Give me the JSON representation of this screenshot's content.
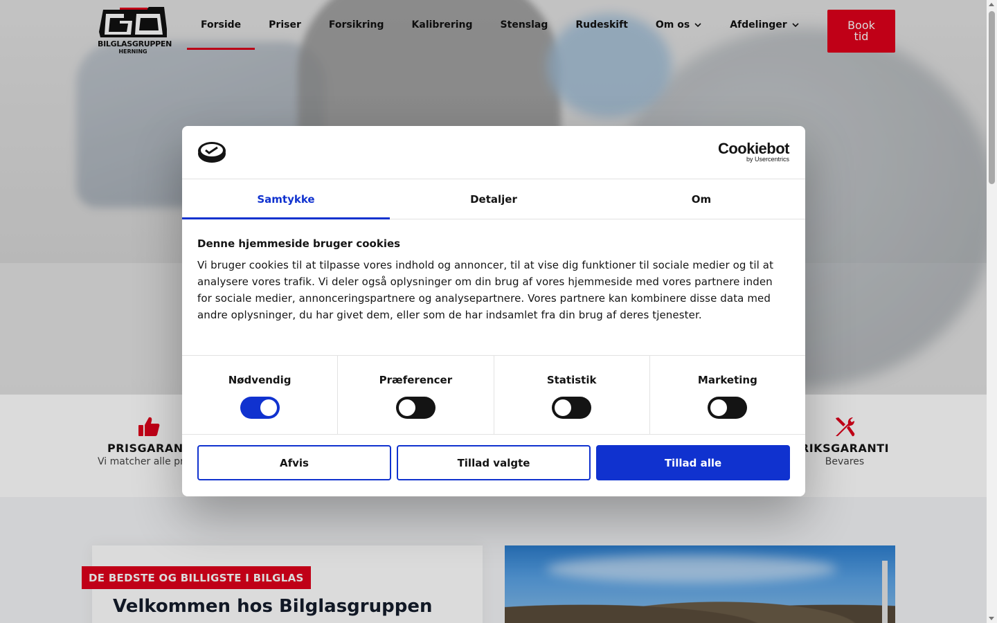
{
  "header": {
    "logo_text": "BILGLASGRUPPEN",
    "logo_sub": "HERNING",
    "nav": [
      {
        "label": "Forside",
        "active": true
      },
      {
        "label": "Priser"
      },
      {
        "label": "Forsikring"
      },
      {
        "label": "Kalibrering"
      },
      {
        "label": "Stenslag"
      },
      {
        "label": "Rudeskift"
      },
      {
        "label": "Om os",
        "dropdown": true
      },
      {
        "label": "Afdelinger",
        "dropdown": true
      }
    ],
    "book_button": "Book\ntid"
  },
  "features": {
    "left": {
      "title": "PRISGARANT",
      "subtitle": "Vi matcher alle pr",
      "icon": "thumbs-up-icon"
    },
    "right": {
      "title": "RIKSGARANTI",
      "subtitle": "Bevares",
      "icon": "tools-icon"
    }
  },
  "content": {
    "badge": "DE BEDSTE OG BILLIGSTE I BILGLAS",
    "welcome_title": "Velkommen hos Bilglasgruppen Herning"
  },
  "cookie_dialog": {
    "brand_name": "Cookiebot",
    "brand_by": "by Usercentrics",
    "tabs": [
      {
        "label": "Samtykke",
        "active": true
      },
      {
        "label": "Detaljer"
      },
      {
        "label": "Om"
      }
    ],
    "title": "Denne hjemmeside bruger cookies",
    "body": "Vi bruger cookies til at tilpasse vores indhold og annoncer, til at vise dig funktioner til sociale medier og til at analysere vores trafik. Vi deler også oplysninger om din brug af vores hjemmeside med vores partnere inden for sociale medier, annonceringspartnere og analysepartnere. Vores partnere kan kombinere disse data med andre oplysninger, du har givet dem, eller som de har indsamlet fra din brug af deres tjenester.",
    "toggles": [
      {
        "label": "Nødvendig",
        "on": true
      },
      {
        "label": "Præferencer",
        "on": false
      },
      {
        "label": "Statistik",
        "on": false
      },
      {
        "label": "Marketing",
        "on": false
      }
    ],
    "buttons": {
      "reject": "Afvis",
      "allow_selected": "Tillad valgte",
      "allow_all": "Tillad alle"
    }
  },
  "colors": {
    "brand_red": "#e0001b",
    "cookie_blue": "#1032cf"
  }
}
